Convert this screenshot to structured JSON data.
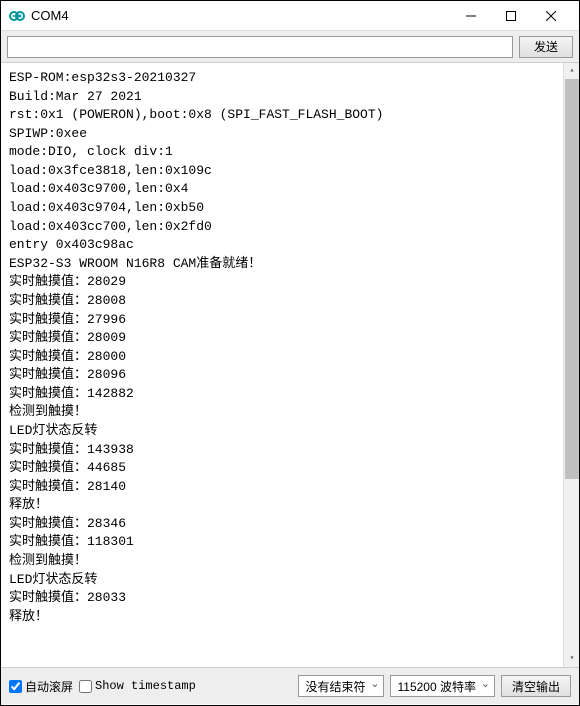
{
  "window": {
    "title": "COM4"
  },
  "toolbar": {
    "input_value": "",
    "send_label": "发送"
  },
  "console_lines": [
    "ESP-ROM:esp32s3-20210327",
    "Build:Mar 27 2021",
    "rst:0x1 (POWERON),boot:0x8 (SPI_FAST_FLASH_BOOT)",
    "SPIWP:0xee",
    "mode:DIO, clock div:1",
    "load:0x3fce3818,len:0x109c",
    "load:0x403c9700,len:0x4",
    "load:0x403c9704,len:0xb50",
    "load:0x403cc700,len:0x2fd0",
    "entry 0x403c98ac",
    "ESP32-S3 WROOM N16R8 CAM准备就绪！",
    "实时触摸值：28029",
    "实时触摸值：28008",
    "实时触摸值：27996",
    "实时触摸值：28009",
    "实时触摸值：28000",
    "实时触摸值：28096",
    "实时触摸值：142882",
    "检测到触摸！",
    "LED灯状态反转",
    "实时触摸值：143938",
    "实时触摸值：44685",
    "实时触摸值：28140",
    "释放！",
    "实时触摸值：28346",
    "实时触摸值：118301",
    "检测到触摸！",
    "LED灯状态反转",
    "实时触摸值：28033",
    "释放！"
  ],
  "bottombar": {
    "autoscroll_label": "自动滚屏",
    "autoscroll_checked": true,
    "timestamp_label": "Show timestamp",
    "timestamp_checked": false,
    "line_ending_selected": "没有结束符",
    "baud_selected": "115200 波特率",
    "clear_label": "清空输出"
  }
}
